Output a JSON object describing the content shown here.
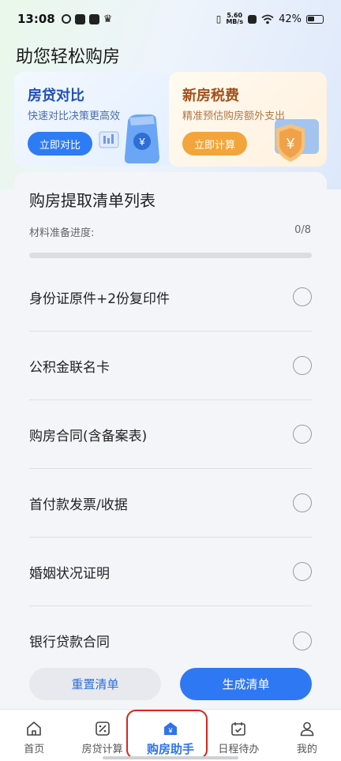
{
  "status_bar": {
    "time": "13:08",
    "net_speed_value": "5.60",
    "net_speed_unit": "MB/s",
    "battery": "42%"
  },
  "page": {
    "title": "助您轻松购房"
  },
  "promos": [
    {
      "title": "房贷对比",
      "subtitle": "快速对比决策更高效",
      "button": "立即对比"
    },
    {
      "title": "新房税费",
      "subtitle": "精准预估购房额外支出",
      "button": "立即计算"
    }
  ],
  "checklist": {
    "title": "购房提取清单列表",
    "progress_label": "材料准备进度:",
    "progress_text": "0/8",
    "progress_fraction": 0,
    "items": [
      {
        "label": "身份证原件+2份复印件",
        "checked": false
      },
      {
        "label": "公积金联名卡",
        "checked": false
      },
      {
        "label": "购房合同(含备案表)",
        "checked": false
      },
      {
        "label": "首付款发票/收据",
        "checked": false
      },
      {
        "label": "婚姻状况证明",
        "checked": false
      },
      {
        "label": "银行贷款合同",
        "checked": false
      }
    ],
    "reset_button": "重置清单",
    "generate_button": "生成清单"
  },
  "tabbar": {
    "active_index": 2,
    "tabs": [
      {
        "label": "首页",
        "icon": "home-icon"
      },
      {
        "label": "房贷计算",
        "icon": "percent-calculator-icon"
      },
      {
        "label": "购房助手",
        "icon": "house-yuan-icon"
      },
      {
        "label": "日程待办",
        "icon": "calendar-check-icon"
      },
      {
        "label": "我的",
        "icon": "person-icon"
      }
    ]
  },
  "colors": {
    "accent": "#2e7bf6",
    "orange_accent": "#f3a53b",
    "highlight": "#d9251c"
  }
}
